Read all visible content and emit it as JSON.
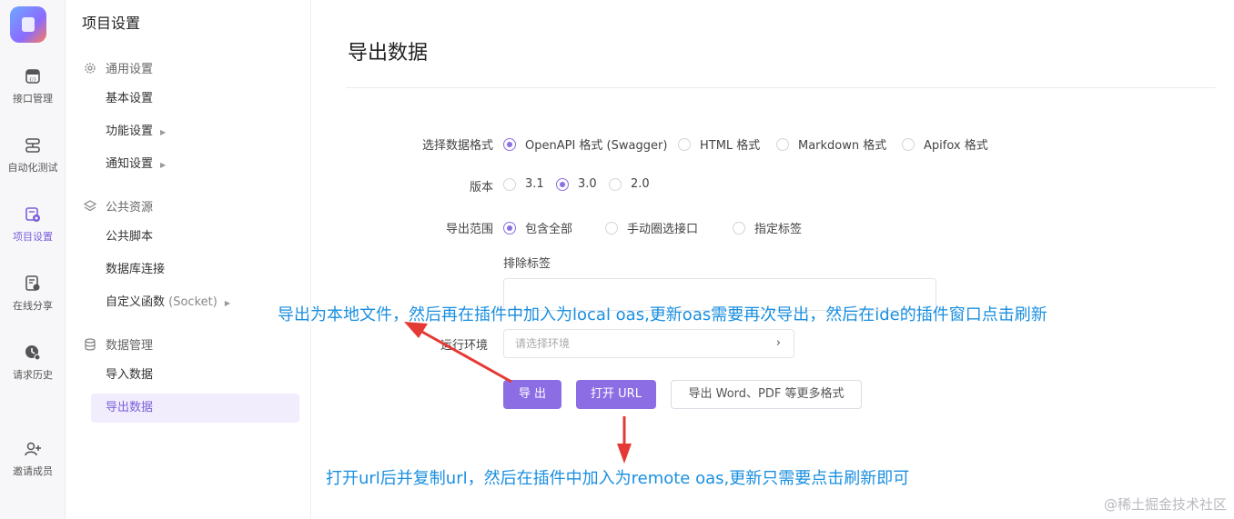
{
  "rail": {
    "items": [
      {
        "label": "接口管理",
        "icon": "api-icon"
      },
      {
        "label": "自动化测试",
        "icon": "automation-icon"
      },
      {
        "label": "项目设置",
        "icon": "project-settings-icon",
        "active": true
      },
      {
        "label": "在线分享",
        "icon": "share-icon"
      },
      {
        "label": "请求历史",
        "icon": "history-icon"
      },
      {
        "label": "邀请成员",
        "icon": "invite-member-icon"
      }
    ]
  },
  "sidebar": {
    "title": "项目设置",
    "groups": [
      {
        "label": "通用设置",
        "icon": "gear-icon"
      },
      {
        "label": "公共资源",
        "icon": "layers-icon"
      },
      {
        "label": "数据管理",
        "icon": "database-icon"
      }
    ],
    "items": [
      {
        "label": "基本设置"
      },
      {
        "label": "功能设置"
      },
      {
        "label": "通知设置"
      },
      {
        "label": "公共脚本"
      },
      {
        "label": "数据库连接"
      },
      {
        "label": "自定义函数",
        "suffix": "(Socket)"
      },
      {
        "label": "导入数据"
      },
      {
        "label": "导出数据",
        "active": true
      }
    ]
  },
  "main": {
    "title": "导出数据",
    "format": {
      "label": "选择数据格式",
      "options": [
        "OpenAPI 格式 (Swagger)",
        "HTML 格式",
        "Markdown 格式",
        "Apifox 格式"
      ],
      "selected": "OpenAPI 格式 (Swagger)"
    },
    "version": {
      "label": "版本",
      "options": [
        "3.1",
        "3.0",
        "2.0"
      ],
      "selected": "3.0"
    },
    "scope": {
      "label": "导出范围",
      "options": [
        "包含全部",
        "手动圈选接口",
        "指定标签"
      ],
      "selected": "包含全部"
    },
    "exclude_tags": {
      "label": "排除标签",
      "value": ""
    },
    "environment": {
      "label": "运行环境",
      "placeholder": "请选择环境"
    },
    "buttons": {
      "export": "导 出",
      "open_url": "打开 URL",
      "more_formats": "导出 Word、PDF 等更多格式"
    }
  },
  "annotations": {
    "note1": "导出为本地文件，然后再在插件中加入为local oas,更新oas需要再次导出，然后在ide的插件窗口点击刷新",
    "note2": "打开url后并复制url，然后在插件中加入为remote oas,更新只需要点击刷新即可",
    "arrow_color": "#e53935",
    "text_color": "#1a8fe0"
  },
  "watermark": "@稀土掘金技术社区",
  "colors": {
    "accent": "#8c6de4"
  }
}
